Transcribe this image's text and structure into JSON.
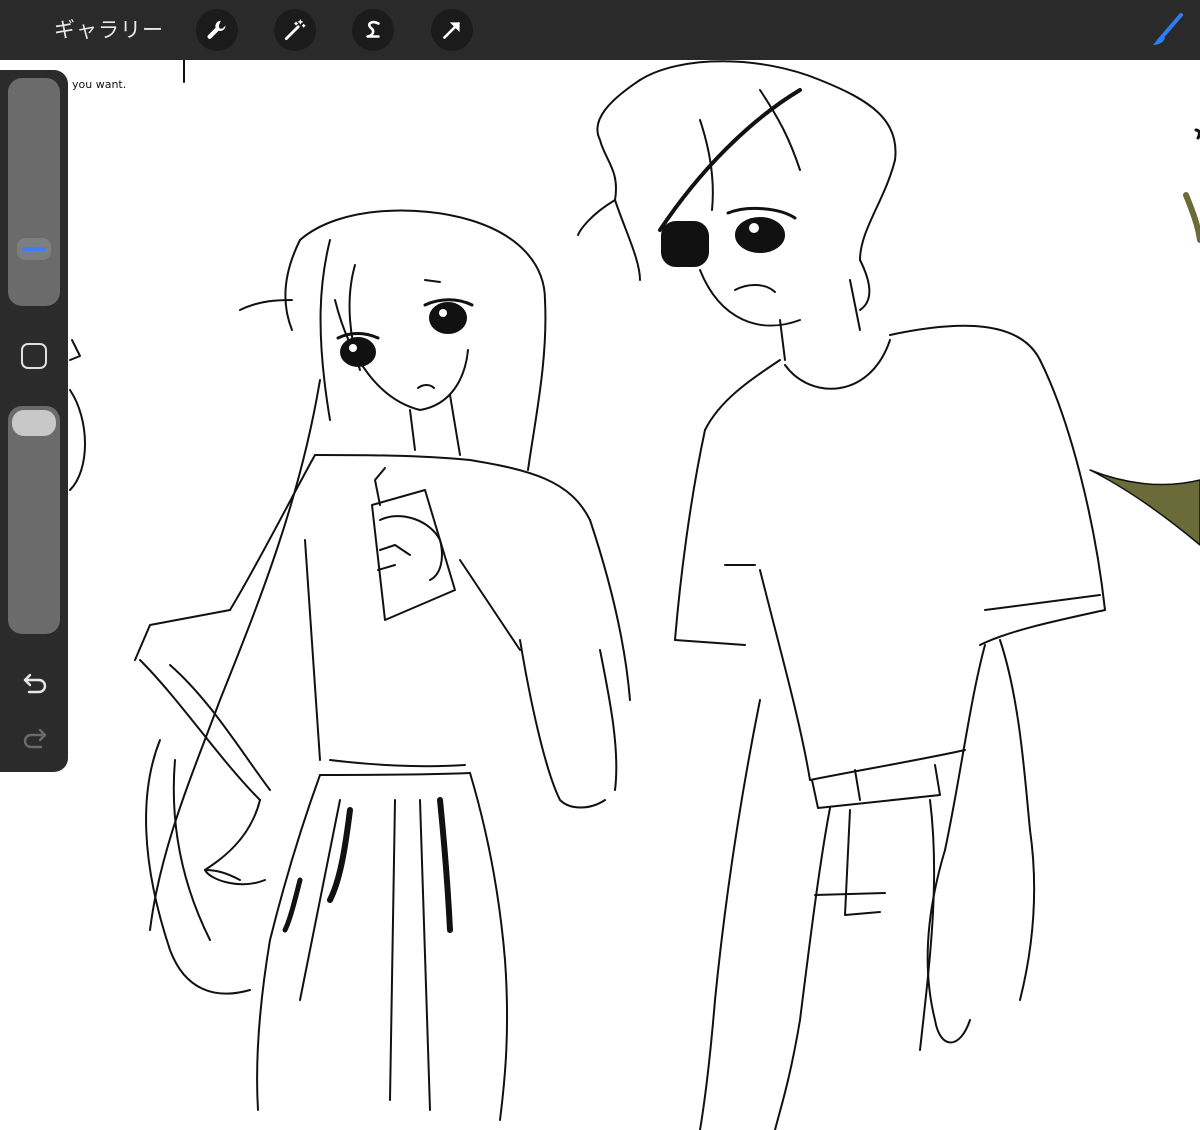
{
  "toolbar": {
    "gallery_label": "ギャラリー",
    "tools": [
      {
        "name": "wrench-icon"
      },
      {
        "name": "magic-wand-icon"
      },
      {
        "name": "selection-icon"
      },
      {
        "name": "transform-arrow-icon"
      }
    ],
    "active_tool": "brush-icon",
    "accent_color": "#2f7cf6"
  },
  "canvas": {
    "corner_note": "you want."
  },
  "sidebar": {
    "controls": [
      "brush-size-slider",
      "modify-button",
      "opacity-slider",
      "undo-icon",
      "redo-icon"
    ]
  },
  "colors": {
    "toolbar_bg": "#2a2a2a",
    "sidebar_bg": "#2b2b2b",
    "olive_shape": "#6b6b3a"
  }
}
